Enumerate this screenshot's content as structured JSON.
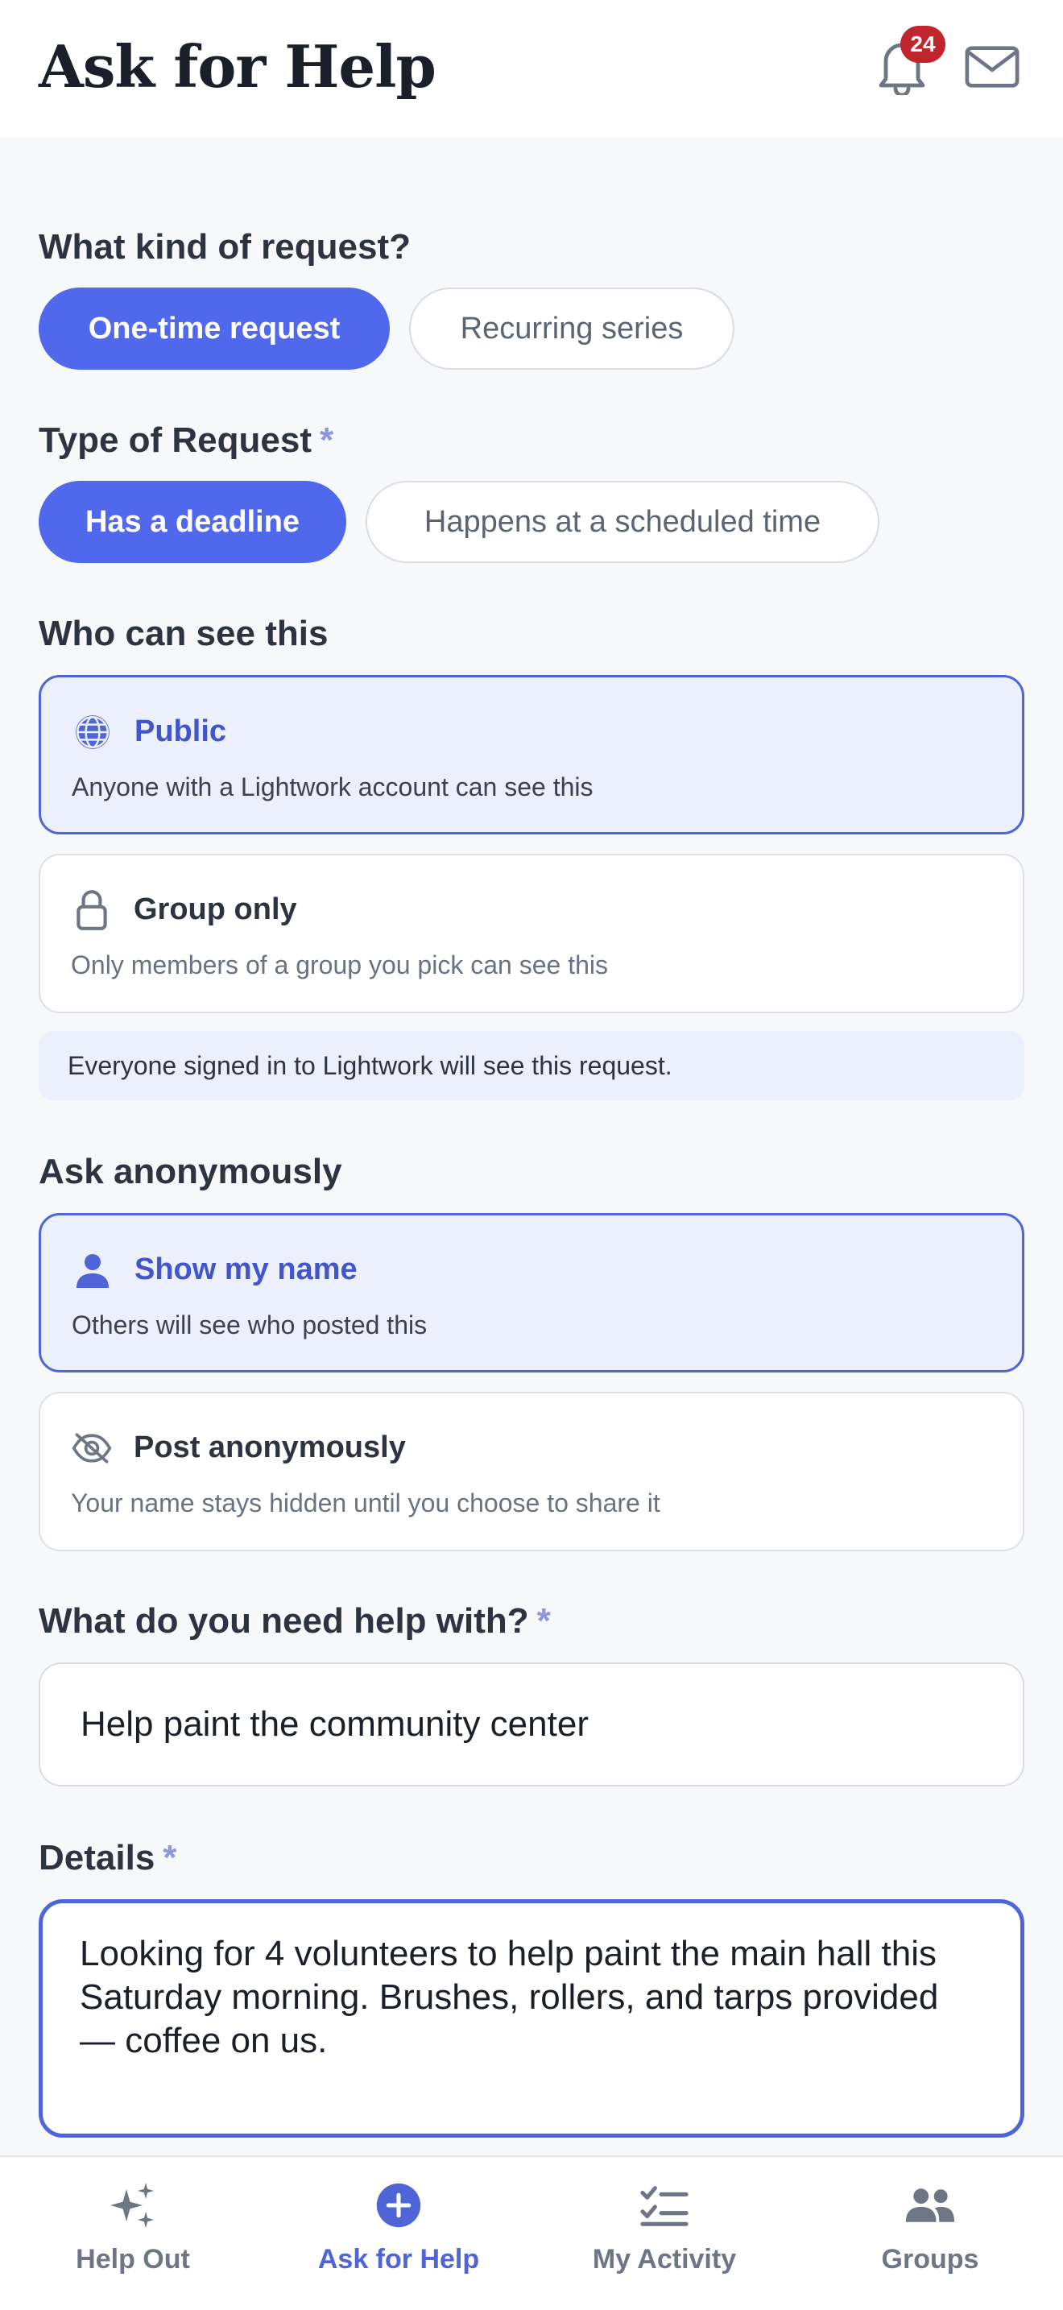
{
  "header": {
    "title": "Ask for Help",
    "notification_count": "24",
    "bell_icon": "bell-icon",
    "mail_icon": "mail-icon"
  },
  "request_kind": {
    "label": "What kind of request?",
    "options": [
      "One-time request",
      "Recurring series"
    ],
    "selected": "One-time request"
  },
  "request_type": {
    "label": "Type of Request",
    "required_mark": "*",
    "options": [
      "Has a deadline",
      "Happens at a scheduled time"
    ],
    "selected": "Has a deadline"
  },
  "visibility": {
    "label": "Who can see this",
    "options": [
      {
        "title": "Public",
        "description": "Anyone with a Lightwork account can see this",
        "icon": "globe-icon",
        "selected": true
      },
      {
        "title": "Group only",
        "description": "Only members of a group you pick can see this",
        "icon": "lock-icon",
        "selected": false
      }
    ],
    "note": "Everyone signed in to Lightwork will see this request."
  },
  "anonymity": {
    "label": "Ask anonymously",
    "options": [
      {
        "title": "Show my name",
        "description": "Others will see who posted this",
        "icon": "person-icon",
        "selected": true
      },
      {
        "title": "Post anonymously",
        "description": "Your name stays hidden until you choose to share it",
        "icon": "eye-off-icon",
        "selected": false
      }
    ]
  },
  "need": {
    "label": "What do you need help with?",
    "required_mark": "*",
    "value": "Help paint the community center"
  },
  "details": {
    "label": "Details",
    "required_mark": "*",
    "value": "Looking for 4 volunteers to help paint the main hall this Saturday morning. Brushes, rollers, and tarps provided — coffee on us."
  },
  "tabbar": {
    "tabs": [
      {
        "label": "Help Out",
        "icon": "sparkles-icon",
        "active": false
      },
      {
        "label": "Ask for Help",
        "icon": "plus-circle-icon",
        "active": true
      },
      {
        "label": "My Activity",
        "icon": "checklist-icon",
        "active": false
      },
      {
        "label": "Groups",
        "icon": "people-icon",
        "active": false
      }
    ]
  },
  "colors": {
    "accent": "#5068ec",
    "selected_card_bg": "#eceffc",
    "badge": "#c0242d"
  }
}
